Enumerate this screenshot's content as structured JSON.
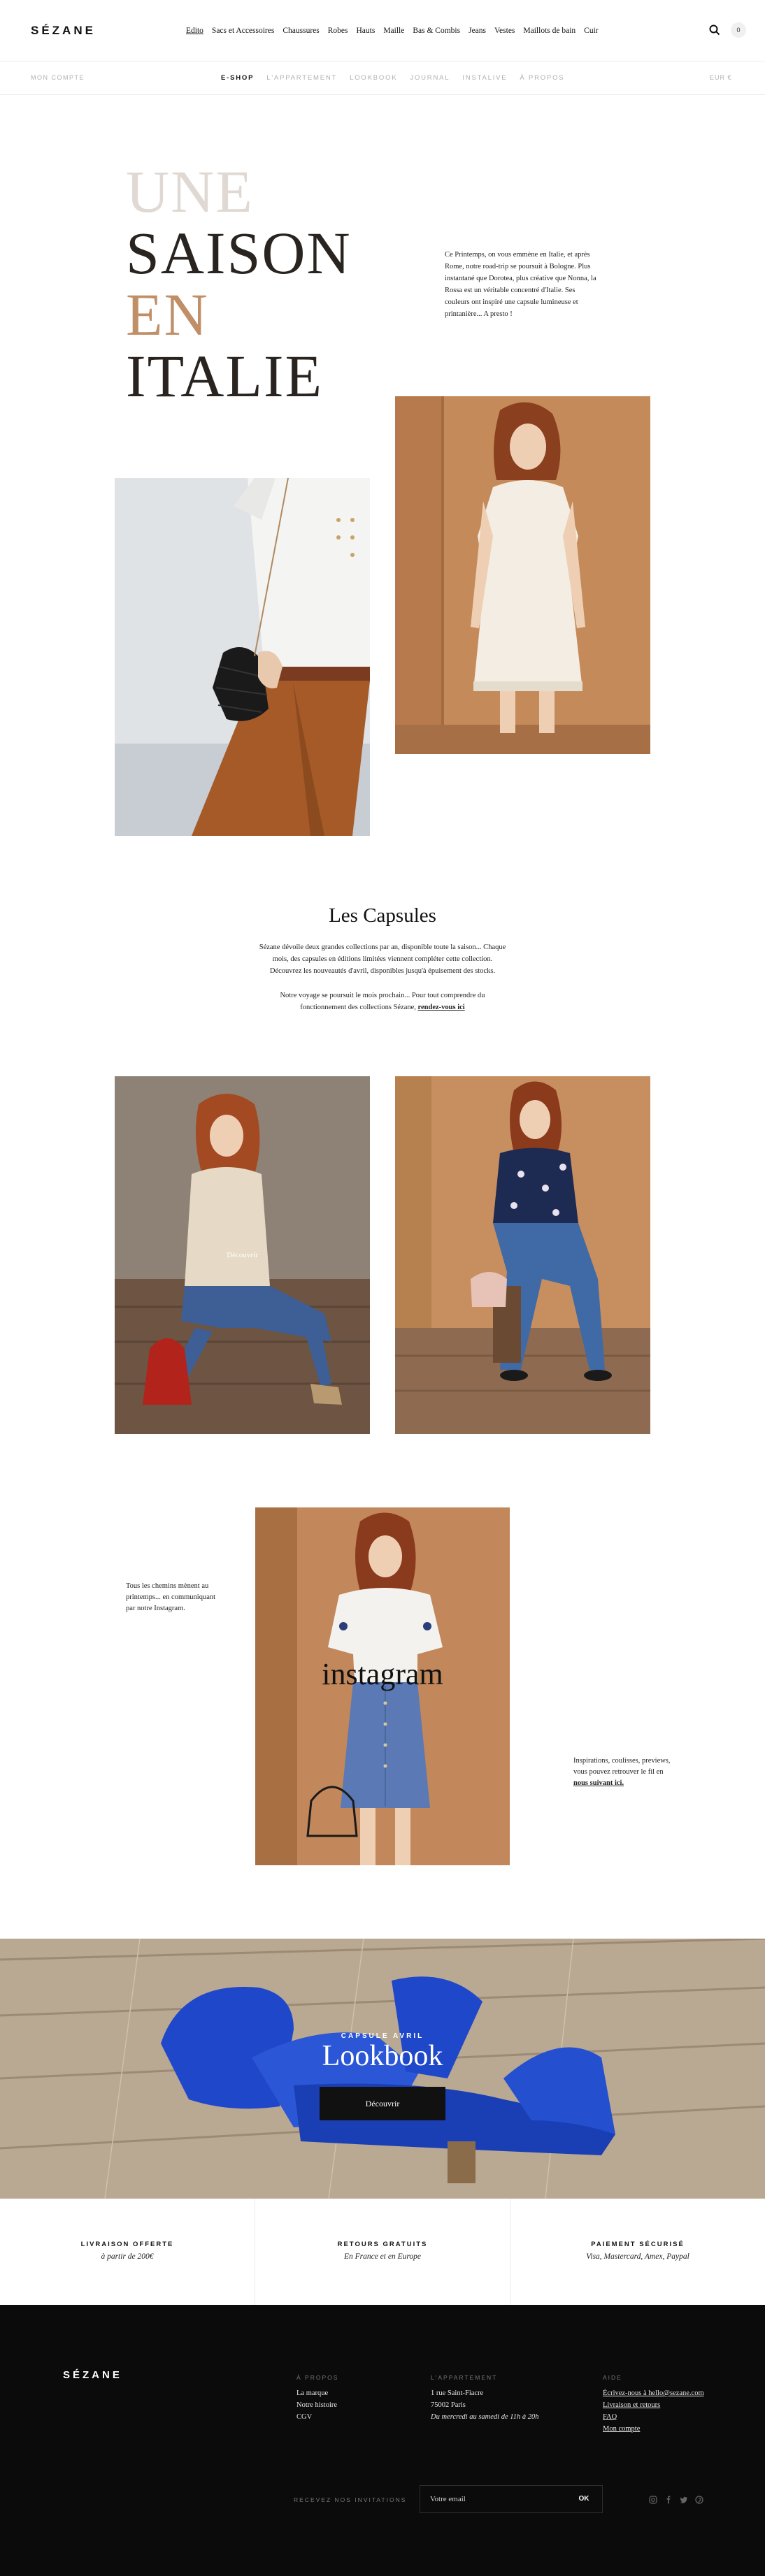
{
  "header": {
    "logo": "SÉZANE",
    "nav": [
      "Edito",
      "Sacs et Accessoires",
      "Chaussures",
      "Robes",
      "Hauts",
      "Maille",
      "Bas & Combis",
      "Jeans",
      "Vestes",
      "Maillots de bain",
      "Cuir"
    ],
    "cart_count": "0"
  },
  "subbar": {
    "account": "MON COMPTE",
    "nav": [
      "E-SHOP",
      "L'APPARTEMENT",
      "LOOKBOOK",
      "JOURNAL",
      "INSTALIVE",
      "À PROPOS"
    ],
    "currency": "EUR €"
  },
  "hero": {
    "title_lines": [
      "UNE",
      "SAISON",
      "EN",
      "ITALIE"
    ],
    "intro": "Ce Printemps, on vous emmène en Italie, et après Rome, notre road-trip se poursuit à Bologne. Plus instantané que Dorotea, plus créative que Nonna, la Rossa est un véritable concentré d'Italie. Ses couleurs ont inspiré une capsule lumineuse et printanière... A presto !"
  },
  "capsules": {
    "title": "Les Capsules",
    "text1": "Sézane dévoile deux grandes collections par an, disponible toute la saison... Chaque mois, des capsules en éditions limitées viennent compléter cette collection. Découvrez les nouveautés d'avril, disponibles jusqu'à épuisement des stocks.",
    "text2": "Notre voyage se poursuit le mois prochain... Pour tout comprendre du fonctionnement des collections Sézane,",
    "link": "rendez-vous ici",
    "overlay_label": "Découvrir"
  },
  "instagram": {
    "left_text": "Tous les chemins mènent au printemps... en communiquant par notre Instagram.",
    "word": "instagram",
    "right_text": "Inspirations, coulisses, previews, vous pouvez retrouver le fil en",
    "right_link": "nous suivant ici."
  },
  "banner": {
    "kicker": "CAPSULE AVRIL",
    "title": "Lookbook",
    "button": "Découvrir"
  },
  "features": [
    {
      "title": "LIVRAISON OFFERTE",
      "sub": "à partir de 200€"
    },
    {
      "title": "RETOURS GRATUITS",
      "sub": "En France et en Europe"
    },
    {
      "title": "PAIEMENT SÉCURISÉ",
      "sub": "Visa, Mastercard, Amex, Paypal"
    }
  ],
  "footer": {
    "logo": "SÉZANE",
    "col1": {
      "head": "À PROPOS",
      "items": [
        "La marque",
        "Notre histoire",
        "CGV"
      ]
    },
    "col2": {
      "head": "L'APPARTEMENT",
      "items": [
        "1 rue Saint-Fiacre",
        "75002 Paris",
        "Du mercredi au samedi de 11h à 20h"
      ]
    },
    "col3": {
      "head": "AIDE",
      "items": [
        "Écrivez-nous à hello@sezane.com",
        "Livraison et retours",
        "FAQ",
        "Mon compte"
      ]
    },
    "newsletter_label": "RECEVEZ NOS INVITATIONS",
    "newsletter_placeholder": "Votre email",
    "newsletter_button": "OK",
    "social": [
      "instagram-icon",
      "facebook-icon",
      "twitter-icon",
      "pinterest-icon"
    ]
  },
  "colors": {
    "accent_copper": "#c08f68",
    "footer_bg": "#0b0b0b",
    "banner_blue": "#1f47c9"
  }
}
